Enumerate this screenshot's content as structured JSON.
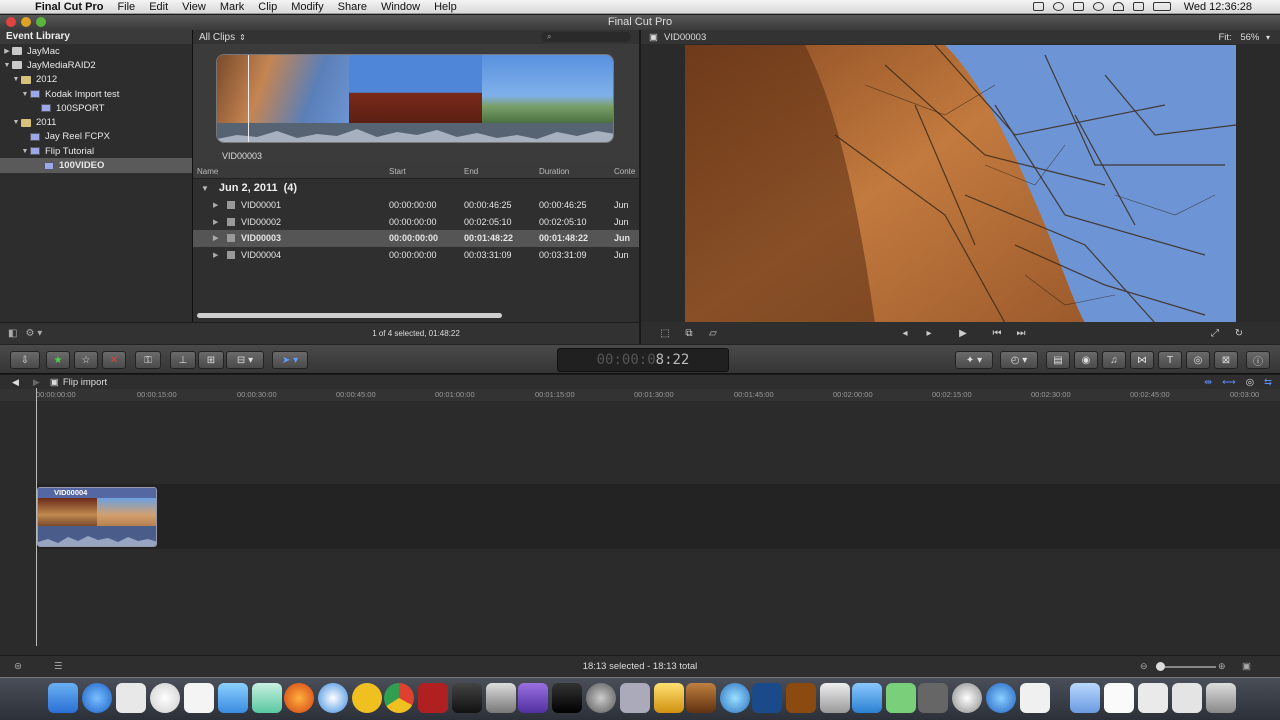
{
  "menubar": {
    "app_name": "Final Cut Pro",
    "items": [
      "File",
      "Edit",
      "View",
      "Mark",
      "Clip",
      "Modify",
      "Share",
      "Window",
      "Help"
    ],
    "clock": "Wed 12:36:28"
  },
  "window": {
    "title": "Final Cut Pro"
  },
  "library": {
    "header": "Event Library",
    "items": [
      {
        "label": "JayMac",
        "icon": "disk-icon"
      },
      {
        "label": "JayMediaRAID2",
        "icon": "disk-icon"
      },
      {
        "label": "2012",
        "icon": "folder-icon"
      },
      {
        "label": "Kodak Import test",
        "icon": "event-icon"
      },
      {
        "label": "100SPORT",
        "icon": "event-icon"
      },
      {
        "label": "2011",
        "icon": "folder-icon"
      },
      {
        "label": "Jay Reel FCPX",
        "icon": "event-icon"
      },
      {
        "label": "Flip Tutorial",
        "icon": "event-icon"
      },
      {
        "label": "100VIDEO",
        "icon": "event-icon"
      }
    ]
  },
  "browser": {
    "filter": "All Clips",
    "skim_label": "VID00003",
    "columns": [
      "Name",
      "Start",
      "End",
      "Duration",
      "Conte"
    ],
    "group": {
      "title": "Jun 2, 2011",
      "count": "(4)"
    },
    "rows": [
      {
        "name": "VID00001",
        "start": "00:00:00:00",
        "end": "00:00:46:25",
        "duration": "00:00:46:25",
        "content": "Jun"
      },
      {
        "name": "VID00002",
        "start": "00:00:00:00",
        "end": "00:02:05:10",
        "duration": "00:02:05:10",
        "content": "Jun"
      },
      {
        "name": "VID00003",
        "start": "00:00:00:00",
        "end": "00:01:48:22",
        "duration": "00:01:48:22",
        "content": "Jun"
      },
      {
        "name": "VID00004",
        "start": "00:00:00:00",
        "end": "00:03:31:09",
        "duration": "00:03:31:09",
        "content": "Jun"
      }
    ],
    "selection_status": "1 of 4 selected, 01:48:22"
  },
  "viewer": {
    "title": "VID00003",
    "fit_label": "Fit:",
    "fit_value": "56%"
  },
  "toolbar": {
    "timecode_dim": "00:00:0",
    "timecode_main": "8:22"
  },
  "timeline": {
    "project_name": "Flip import",
    "ruler": [
      "00:00:00:00",
      "00:00:15:00",
      "00:00:30:00",
      "00:00:45:00",
      "00:01:00:00",
      "00:01:15:00",
      "00:01:30:00",
      "00:01:45:00",
      "00:02:00:00",
      "00:02:15:00",
      "00:02:30:00",
      "00:02:45:00",
      "00:03:00"
    ],
    "clip_name": "VID00004",
    "status": "18:13 selected - 18:13 total"
  },
  "colors": {
    "accent_blue": "#2a6fd6",
    "selection_gray": "#555555",
    "sky_blue": "#6d94d4",
    "dirt_orange": "#c0783a"
  }
}
